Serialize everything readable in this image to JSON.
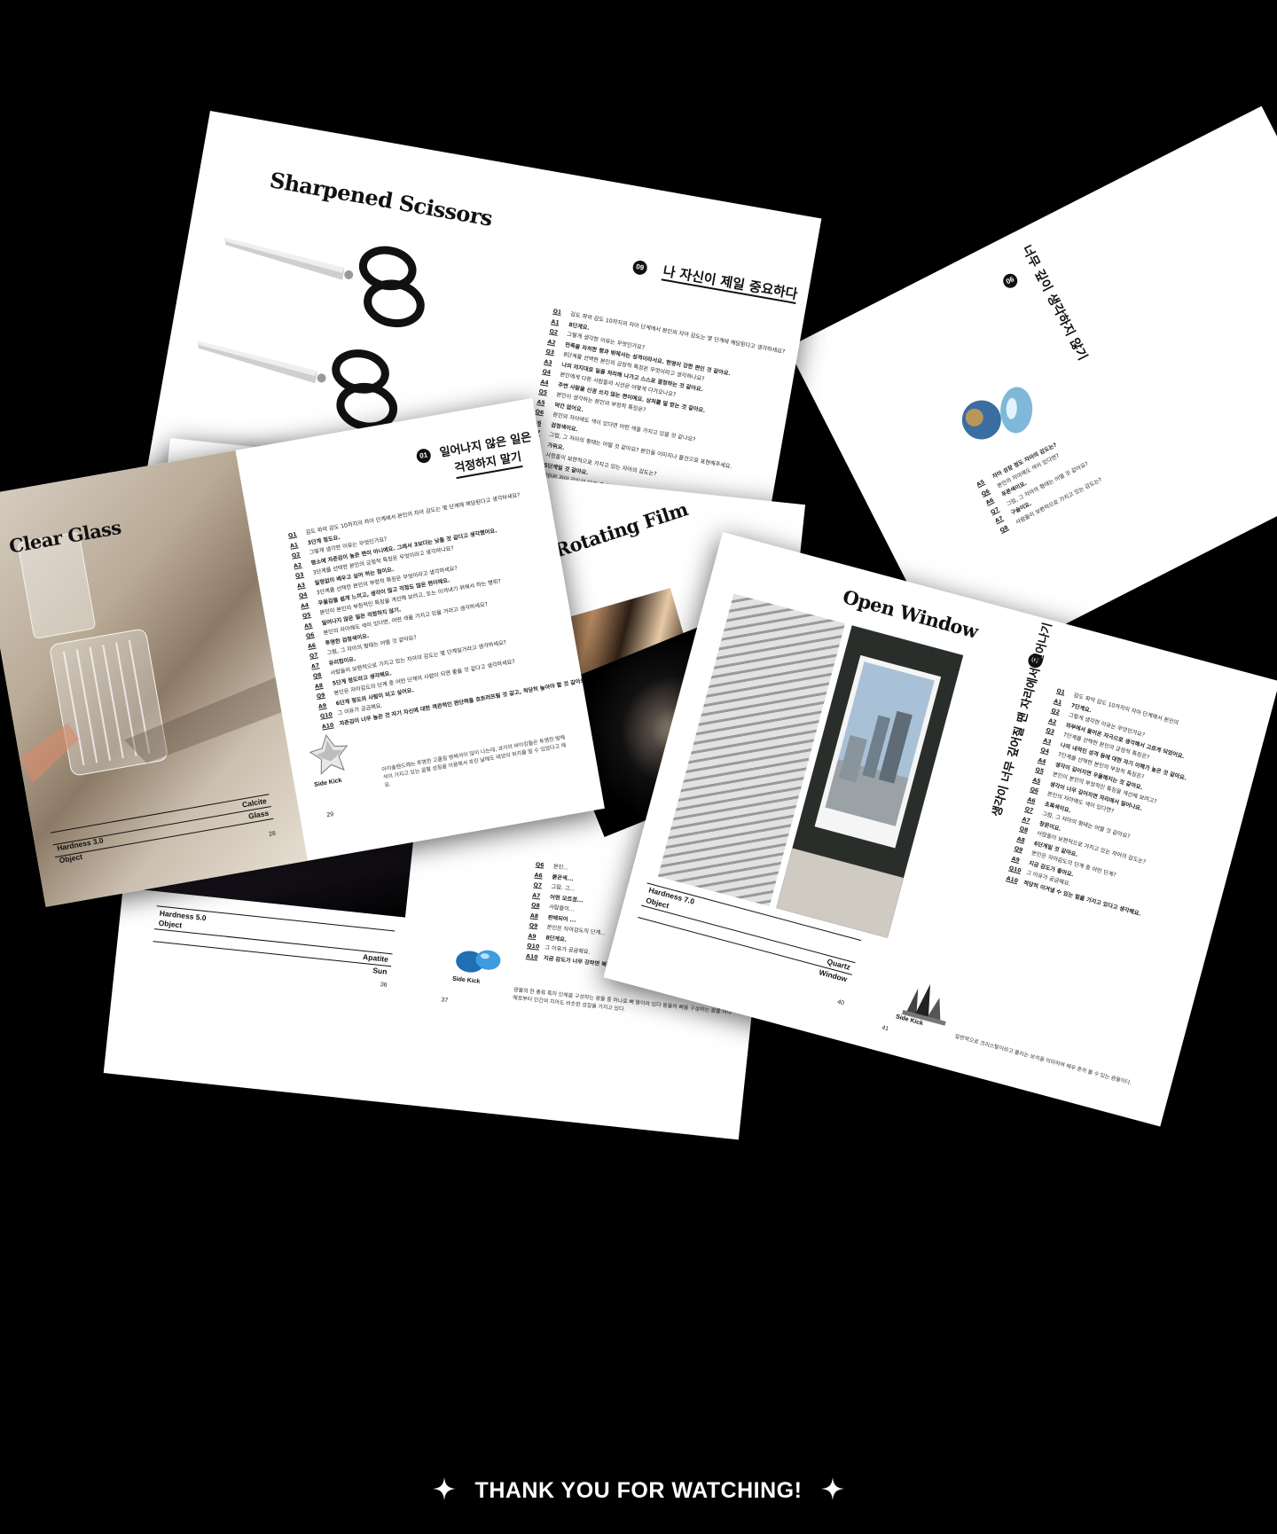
{
  "spreads": {
    "scissors": {
      "title": "Sharpened Scissors",
      "section_num": "09",
      "section_title": "나 자신이 제일 중요하다",
      "qa": [
        {
          "l": "Q1",
          "t": "감도 파악 감도 10까지의 자아 단계에서 본인의 자아 감도는 몇 단계에 해당된다고 생각하세요?"
        },
        {
          "l": "A1",
          "t": "8단계요."
        },
        {
          "l": "Q2",
          "t": "그렇게 생각한 이유는 무엇인가요?"
        },
        {
          "l": "A2",
          "t": "만족을 자처한 행과 밖에서는 성격이라서요. 현명이 강한 편인 것 같아요."
        },
        {
          "l": "Q3",
          "t": "8단계를 선택한 본인의 긍정적 특징은 무엇이라고 생각하나요?"
        },
        {
          "l": "A3",
          "t": "나의 의지대로 일을 처리해 나가고 스스로 결정하는 것 같아요."
        },
        {
          "l": "Q4",
          "t": "본인에게 다른 사람들의 시선은 어떻게 다가오나요?"
        },
        {
          "l": "A4",
          "t": "주변 사람을 신경 쓰지 않는 편이에요. 상처를 덜 받는 것 같아요."
        },
        {
          "l": "Q5",
          "t": "본인이 생각하는 본인의 부정적 특징은?"
        },
        {
          "l": "A5",
          "t": "약간 없어요."
        },
        {
          "l": "Q6",
          "t": "본인의 자아에도 색이 있다면 어떤 색을 가지고 있을 것 같나요?"
        },
        {
          "l": "A6",
          "t": "검정색이요."
        },
        {
          "l": "Q7",
          "t": "그럼, 그 자아의 형태는 어떨 것 같아요? 본인을 이미지나 물건으로 표현해주세요."
        },
        {
          "l": "A7",
          "t": "가위요."
        },
        {
          "l": "Q8",
          "t": "사람들이 보편적으로 가지고 있는 자아의 감도는?"
        },
        {
          "l": "A8",
          "t": "5단계일 것 같아요."
        },
        {
          "l": "Q9",
          "t": "본인은 자아 감도의 단계 중 어떤 단계?"
        },
        {
          "l": "A9",
          "t": "8단계의 사람이 되고 싶어요."
        },
        {
          "l": "Q10",
          "t": "그 이유가 궁금해요."
        },
        {
          "l": "A10",
          "t": "행복은 강함수록 좋다고 생각해요."
        }
      ]
    },
    "glass": {
      "title": "Clear Glass",
      "section_num": "01",
      "section_title_1": "일어나지 않은 일은",
      "section_title_2": "걱정하지 말기",
      "qa": [
        {
          "l": "Q1",
          "t": "감도 파악 감도 10까지의 자아 단계에서 본인의 자아 감도는 몇 단계에 해당된다고 생각하세요?"
        },
        {
          "l": "A1",
          "t": "3단계 정도요."
        },
        {
          "l": "Q2",
          "t": "그렇게 생각한 이유는 무엇인가요?"
        },
        {
          "l": "A2",
          "t": "평소에 자존감이 높은 편이 아니에요. 그래서 3보다는 낮을 것 같다고 생각했어요."
        },
        {
          "l": "Q3",
          "t": "3단계를 선택한 본인의 긍정적 특징은 무엇이라고 생각하나요?"
        },
        {
          "l": "A3",
          "t": "일정없이 배우고 싶어 하는 점이요."
        },
        {
          "l": "Q4",
          "t": "3단계를 선택한 본인의 부정적 특징은 무엇이라고 생각하세요?"
        },
        {
          "l": "A4",
          "t": "우울감을 쉽게 느끼고, 생각이 많고 걱정도 많은 편이에요."
        },
        {
          "l": "Q5",
          "t": "본인이 본인의 부정적인 특징을 개선해 보려고, 또는 이겨내기 위해서 하는 행위?"
        },
        {
          "l": "A5",
          "t": "일어나지 않은 일은 걱정하지 않기."
        },
        {
          "l": "Q6",
          "t": "본인의 자아에도 색이 있다면, 어떤 색을 가지고 있을 거라고 생각하세요?"
        },
        {
          "l": "A6",
          "t": "투명한 검정색이요."
        },
        {
          "l": "Q7",
          "t": "그럼, 그 자아의 형태는 어떨 것 같아요?"
        },
        {
          "l": "A7",
          "t": "유리컵이요."
        },
        {
          "l": "Q8",
          "t": "사람들이 보편적으로 가지고 있는 자아의 감도는 몇 단계일거라고 생각하세요?"
        },
        {
          "l": "A8",
          "t": "5단계 정도라고 생각해요."
        },
        {
          "l": "Q9",
          "t": "본인은 자아감도의 단계 중 어떤 단계의 사람이 되면 좋을 것 같다고 생각하세요?"
        },
        {
          "l": "A9",
          "t": "6단계 정도의 사람이 되고 싶어요."
        },
        {
          "l": "Q10",
          "t": "그 이유가 궁금해요."
        },
        {
          "l": "A10",
          "t": "자존감이 너무 높은 건 자기 자신에 대한 객관적인 판단력을 흐트러뜨릴 것 같고, 적당히 높아야 할 것 같아요."
        }
      ],
      "note": "아이솔렌드에는 투명한 고품질 방해석이 많이 나는데, 과거의 바이킹들은 투명한 방해석이 가지고 있는 굴절 성질을 이용해서 흐린 날에도 태양의 위치를 알 수 있었다고 해요.",
      "sidekick": "Side Kick",
      "page_left": "28",
      "page_right": "29",
      "hardness": "Hardness 3.0",
      "object": "Object",
      "mineral": "Calcite",
      "obj_value": "Glass"
    },
    "film": {
      "title": "Rotating Film",
      "hardness": "Hardness 5.0",
      "object": "Object",
      "mineral": "Apatite",
      "obj_value": "Sun",
      "page_left": "36",
      "page_right": "37",
      "sidekick": "Side Kick",
      "qa": [
        {
          "l": "Q6",
          "t": "본인..."
        },
        {
          "l": "A6",
          "t": "붉은색..."
        },
        {
          "l": "Q7",
          "t": "그럼, 그..."
        },
        {
          "l": "A7",
          "t": "어떤 모르겠..."
        },
        {
          "l": "Q8",
          "t": "사람들이..."
        },
        {
          "l": "A8",
          "t": "판매되어 ..."
        },
        {
          "l": "Q9",
          "t": "본인은 자아감도의 단계..."
        },
        {
          "l": "A9",
          "t": "8단계요."
        },
        {
          "l": "Q10",
          "t": "그 이유가 궁금해요."
        },
        {
          "l": "A10",
          "t": "지금 감도가 너무 강하면 복잡해진 사람이 될 것 같아요. 적당히 무너지기도 하고 적당히 이겨낼 수도 있는 단계거든요."
        }
      ],
      "note": "광물의 한 종류 특히 인체를 구성하는 광물 중 하나로 뼈 말이라 있다 동물의 뼈를 구성하는 광물 이다 예로부터 인간의 치아도 비슷한 성질을 가지고 있다."
    },
    "window": {
      "title": "Open Window",
      "hardness": "Hardness 7.0",
      "object": "Object",
      "mineral": "Quartz",
      "obj_value": "Window",
      "page_left": "40",
      "page_right": "41",
      "sidekick": "Side Kick",
      "section_num": "07",
      "section_title": "생각이 너무 깊어질 땐 자리에서 일어나기",
      "qa": [
        {
          "l": "Q1",
          "t": "감도 파악 감도 10까지의 자아 단계에서 본인의"
        },
        {
          "l": "A1",
          "t": "7단계요."
        },
        {
          "l": "Q2",
          "t": "그렇게 생각한 이유는 무엇인가요?"
        },
        {
          "l": "A2",
          "t": "외부에서 들어온 자극으로 생각해서 고르게 되었어요."
        },
        {
          "l": "Q3",
          "t": "7단계를 선택한 본인의 긍정적 특징은?"
        },
        {
          "l": "A3",
          "t": "나의 내적인 성격 등에 대한 자기 이해가 높은 것 같아요."
        },
        {
          "l": "Q4",
          "t": "7단계를 선택한 본인의 부정적 특징은?"
        },
        {
          "l": "A4",
          "t": "생각이 깊어지면 우울해지는 것 같아요."
        },
        {
          "l": "Q5",
          "t": "본인이 본인의 부정적인 특징을 개선해 보려고?"
        },
        {
          "l": "A5",
          "t": "생각이 너무 깊어지면 자리에서 일어나요."
        },
        {
          "l": "Q6",
          "t": "본인의 자아에도 색이 있다면?"
        },
        {
          "l": "A6",
          "t": "초록색이요."
        },
        {
          "l": "Q7",
          "t": "그럼, 그 자아의 형태는 어떨 것 같아요?"
        },
        {
          "l": "A7",
          "t": "창문이요."
        },
        {
          "l": "Q8",
          "t": "사람들이 보편적으로 가지고 있는 자아의 감도는?"
        },
        {
          "l": "A8",
          "t": "6단계일 것 같아요."
        },
        {
          "l": "Q9",
          "t": "본인은 자아감도의 단계 중 어떤 단계?"
        },
        {
          "l": "A9",
          "t": "지금 감도가 좋아요."
        },
        {
          "l": "Q10",
          "t": "그 이유가 궁금해요."
        },
        {
          "l": "A10",
          "t": "적당히 이겨낼 수 있는 힘을 가지고 있다고 생각해요."
        }
      ],
      "note": "일반적으로 크리스탈이라고 불리는 보석을 의미하며 매우 흔히 볼 수 있는 광물이다."
    },
    "gem": {
      "section_num": "06",
      "section_title": "너무 깊이 생각하지 않기",
      "qa": [
        {
          "l": "A5",
          "t": "자아 성장 정도 자아의 감도는?"
        },
        {
          "l": "Q6",
          "t": "본인의 자아에도 색이 있다면?"
        },
        {
          "l": "A6",
          "t": "푸른색이요."
        },
        {
          "l": "Q7",
          "t": "그럼, 그 자아의 형태는 어떨 것 같아요?"
        },
        {
          "l": "A7",
          "t": "구슬이요."
        },
        {
          "l": "Q8",
          "t": "사람들이 보편적으로 가지고 있는 감도는?"
        }
      ]
    }
  },
  "footer": {
    "text": "THANK YOU FOR WATCHING!",
    "spark_left_icon": "sparkle-icon",
    "spark_right_icon": "sparkle-icon"
  }
}
